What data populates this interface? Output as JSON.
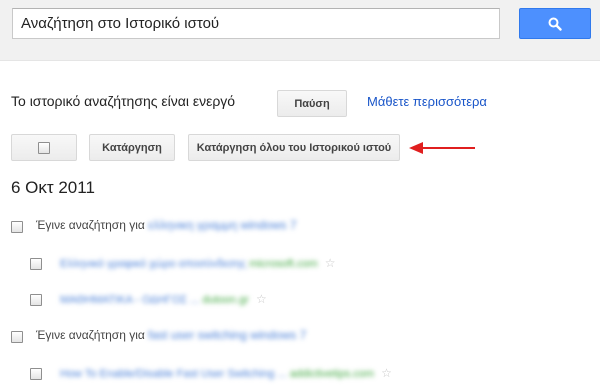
{
  "search": {
    "value": "Αναζήτηση στο Ιστορικό ιστού",
    "button_icon": "search-icon"
  },
  "status": {
    "text": "Το ιστορικό αναζήτησης είναι ενεργό",
    "pause_label": "Παύση",
    "learn_more_label": "Μάθετε περισσότερα"
  },
  "toolbar": {
    "remove_label": "Κατάργηση",
    "remove_all_label": "Κατάργηση όλου του Ιστορικού ιστού"
  },
  "date_heading": "6 Οκτ 2011",
  "groups": [
    {
      "prefix": "Έγινε αναζήτηση για",
      "query": "ελληνικη γραμμη windows 7",
      "results": [
        {
          "title": "Ελληνικό γραφικό χώρο αποσύνδεσης",
          "site": "microsoft.com"
        },
        {
          "title": "ΜΑΘΗΜΑΤΙΚΑ - ΟΔΗΓΟΣ ...",
          "site": "dutoon.gr"
        }
      ]
    },
    {
      "prefix": "Έγινε αναζήτηση για",
      "query": "fast user switching windows 7",
      "results": [
        {
          "title": "How To Enable/Disable Fast User Switching ...",
          "site": "addictivetips.com"
        }
      ]
    }
  ],
  "colors": {
    "accent": "#4d90fe",
    "link": "#1a56c9",
    "arrow": "#e01f1f",
    "url": "#42a942"
  }
}
